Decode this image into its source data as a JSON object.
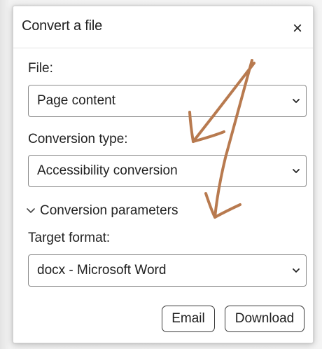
{
  "dialog": {
    "title": "Convert a file",
    "close_label": "×"
  },
  "file": {
    "label": "File:",
    "value": "Page content"
  },
  "conversion_type": {
    "label": "Conversion type:",
    "value": "Accessibility conversion"
  },
  "parameters": {
    "toggle_label": "Conversion parameters",
    "expanded": true
  },
  "target_format": {
    "label": "Target format:",
    "value": "docx - Microsoft Word"
  },
  "actions": {
    "email_label": "Email",
    "download_label": "Download"
  },
  "annotation": {
    "color": "#b87a4f",
    "description_icons": [
      "arrow-icon",
      "arrow-icon"
    ]
  }
}
